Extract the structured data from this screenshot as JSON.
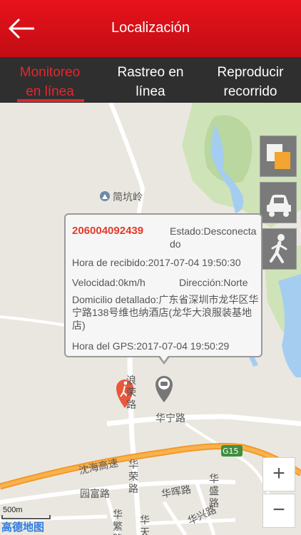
{
  "header": {
    "title": "Localización"
  },
  "tabs": [
    {
      "label": "Monitoreo\nen línea"
    },
    {
      "label": "Rastreo en\nlínea"
    },
    {
      "label": "Reproducir\nrecorrido"
    }
  ],
  "popup": {
    "imei": "206004092439",
    "status": "Estado:Desconectado",
    "received": "Hora de recibido:2017-07-04 19:50:30",
    "speed": "Velocidad:0km/h",
    "direction": "Dirección:Norte",
    "address": "Domicilio detallado:广东省深圳市龙华区华宁路138号维也纳酒店(龙华大浪服装基地店)",
    "gps_time": "Hora del GPS:2017-07-04 19:50:29"
  },
  "map": {
    "poi": "简坑岭",
    "road_langrong": "浪荣路",
    "road_huaning": "华宁路",
    "highway_badge": "G15",
    "highway": "沈海高速",
    "road_huarong": "华荣路",
    "road_yuanfu": "园富路",
    "road_huahui": "华晖路",
    "road_huasheng": "华盛路",
    "road_huafan": "华繁路",
    "road_huatian": "华天路",
    "road_huaxing": "华兴路",
    "scale": "500m",
    "logo": "高德地图"
  },
  "controls": {
    "zoom_in": "+",
    "zoom_out": "−"
  },
  "icons": [
    "back-arrow-icon",
    "map-layer-icon",
    "car-icon",
    "walking-person-icon",
    "car-marker-icon",
    "pedestrian-poi-icon",
    "mountain-poi-icon"
  ]
}
